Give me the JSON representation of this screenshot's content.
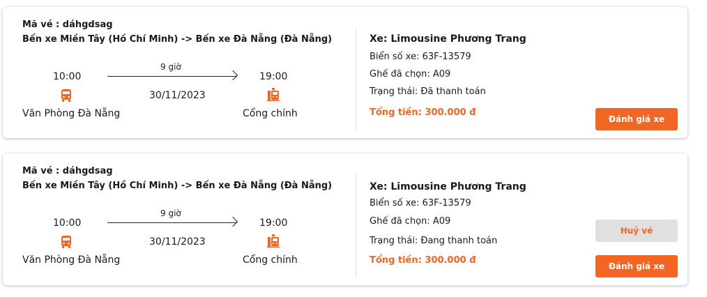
{
  "colors": {
    "accent": "#f26522",
    "cancel_bg": "#e0e0e0"
  },
  "tickets": [
    {
      "code": "Mã vé : dáhgdsag",
      "route": "Bến xe Miền Tây (Hồ Chí Minh) -> Bến xe Đà Nẵng (Đà Nẵng)",
      "depart_time": "10:00",
      "duration": "9 giờ",
      "date": "30/11/2023",
      "arrive_time": "19:00",
      "depart_place": "Văn Phòng Đà Nẵng",
      "arrive_place": "Cổng chính",
      "depart_icon": "bus-icon",
      "arrive_icon": "bus-station-icon",
      "operator": "Xe: Limousine Phương Trang",
      "plate": "Biển số xe: 63F-13579",
      "seat": "Ghế đã chọn: A09",
      "status": "Trạng thái: Đã thanh toán",
      "total": "Tổng tiền: 300.000 đ",
      "rate_label": "Đánh giá xe"
    },
    {
      "code": "Mã vé : dáhgdsag",
      "route": "Bến xe Miền Tây (Hồ Chí Minh) -> Bến xe Đà Nẵng (Đà Nẵng)",
      "depart_time": "10:00",
      "duration": "9 giờ",
      "date": "30/11/2023",
      "arrive_time": "19:00",
      "depart_place": "Văn Phòng Đà Nẵng",
      "arrive_place": "Cổng chính",
      "depart_icon": "bus-icon",
      "arrive_icon": "bus-station-icon",
      "operator": "Xe: Limousine Phương Trang",
      "plate": "Biển số xe: 63F-13579",
      "seat": "Ghế đã chọn: A09",
      "status": "Trạng thái: Đang thanh toán",
      "total": "Tổng tiền: 300.000 đ",
      "cancel_label": "Huỷ vé",
      "rate_label": "Đánh giá xe"
    }
  ]
}
